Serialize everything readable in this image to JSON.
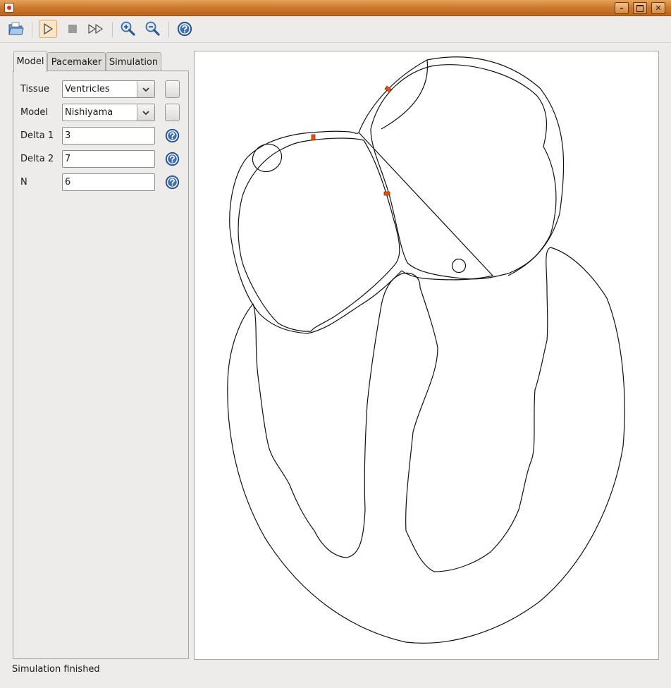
{
  "window": {
    "title": "",
    "controls": {
      "minimize": "minimize-icon",
      "maximize": "maximize-icon",
      "close": "close-icon"
    }
  },
  "toolbar": {
    "buttons": [
      {
        "name": "open-button",
        "icon": "folder-open-icon"
      },
      {
        "name": "play-button",
        "icon": "play-icon",
        "active": true
      },
      {
        "name": "stop-button",
        "icon": "stop-icon"
      },
      {
        "name": "fast-forward-button",
        "icon": "fast-forward-icon"
      },
      {
        "name": "zoom-in-button",
        "icon": "zoom-in-icon"
      },
      {
        "name": "zoom-out-button",
        "icon": "zoom-out-icon"
      },
      {
        "name": "help-button",
        "icon": "help-icon"
      }
    ]
  },
  "tabs": [
    {
      "label": "Model",
      "selected": true
    },
    {
      "label": "Pacemaker",
      "selected": false
    },
    {
      "label": "Simulation",
      "selected": false
    }
  ],
  "form": {
    "tissue": {
      "label": "Tissue",
      "value": "Ventricles"
    },
    "model": {
      "label": "Model",
      "value": "Nishiyama"
    },
    "delta1": {
      "label": "Delta 1",
      "value": "3"
    },
    "delta2": {
      "label": "Delta 2",
      "value": "7"
    },
    "n": {
      "label": "N",
      "value": "6"
    }
  },
  "status": {
    "text": "Simulation finished"
  },
  "colors": {
    "titlebar": "#c9752a",
    "accent_active": "#fbe6c9",
    "pacemaker_marker": "#e8500e",
    "help_icon": "#3f6fb0"
  }
}
